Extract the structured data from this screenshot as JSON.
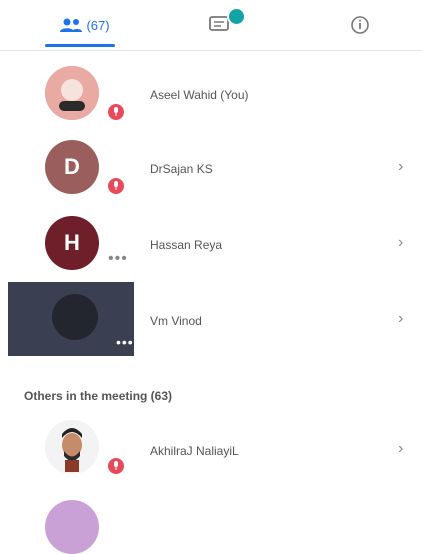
{
  "tabs": {
    "participants": {
      "count": "(67)",
      "icon": "people-icon"
    },
    "chat": {
      "icon": "chat-icon",
      "badge_color": "#12a4a4"
    },
    "info": {
      "icon": "info-icon"
    }
  },
  "participants": [
    {
      "name": "Aseel Wahid (You)",
      "avatar_type": "photo",
      "muted": true
    },
    {
      "name": "DrSajan KS",
      "initial": "D",
      "avatar_color": "#9a5e5c",
      "muted": true
    },
    {
      "name": "Hassan Reya",
      "initial": "H",
      "avatar_color": "#6e1f2a",
      "muted": false
    },
    {
      "name": "Vm Vinod",
      "avatar_type": "video",
      "muted": false
    }
  ],
  "section_title": "Others in the meeting (63)",
  "others": [
    {
      "name": "AkhilraJ NaliayiL",
      "avatar_type": "photo",
      "muted": true
    }
  ],
  "colors": {
    "accent": "#1a73e8",
    "muted_badge": "#e84a5a"
  }
}
